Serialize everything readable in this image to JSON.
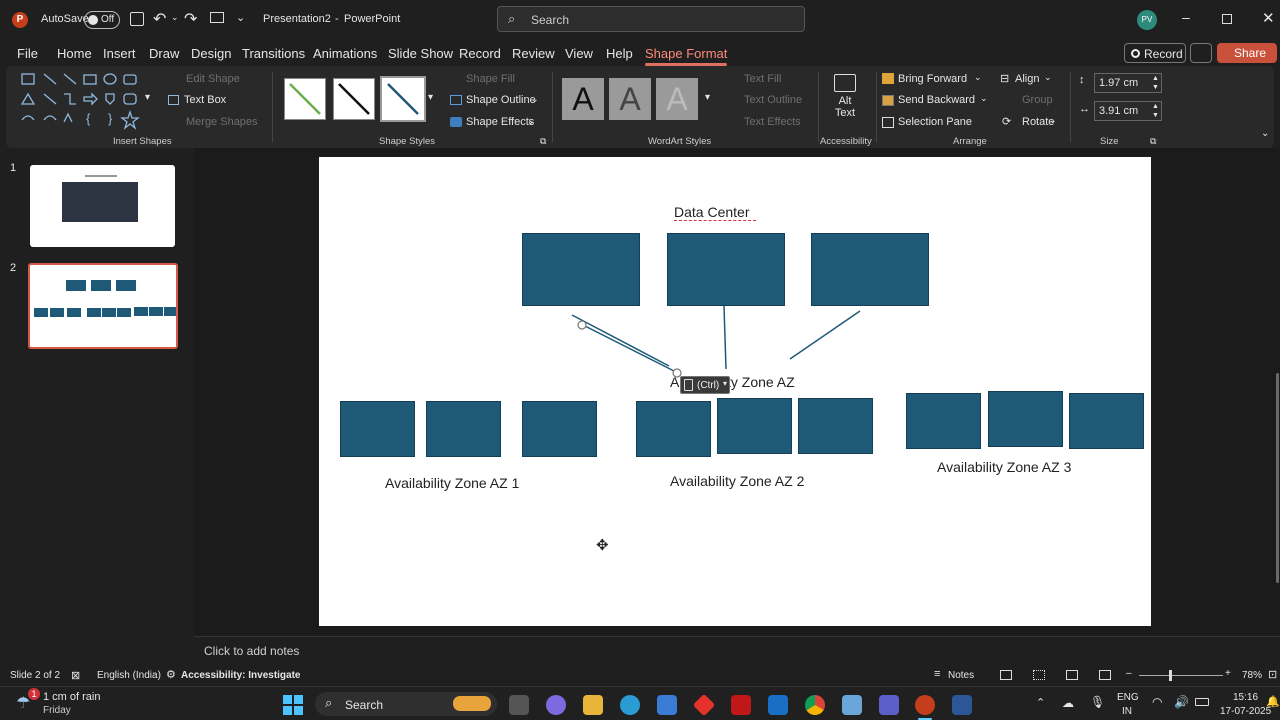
{
  "titlebar": {
    "autosave_label": "AutoSave",
    "autosave_state": "Off",
    "doc_title": "Presentation2",
    "app_name": "PowerPoint",
    "search_placeholder": "Search",
    "user_initials": "PV"
  },
  "menu": {
    "items": [
      "File",
      "Home",
      "Insert",
      "Draw",
      "Design",
      "Transitions",
      "Animations",
      "Slide Show",
      "Record",
      "Review",
      "View",
      "Help",
      "Shape Format"
    ],
    "active": "Shape Format",
    "record_button": "Record",
    "share_button": "Share"
  },
  "ribbon": {
    "insert_shapes": {
      "label": "Insert Shapes",
      "edit_shape": "Edit Shape",
      "text_box": "Text Box",
      "merge_shapes": "Merge Shapes"
    },
    "shape_styles": {
      "label": "Shape Styles",
      "shape_fill": "Shape Fill",
      "shape_outline": "Shape Outline",
      "shape_effects": "Shape Effects"
    },
    "wordart_styles": {
      "label": "WordArt Styles",
      "sample": "A",
      "text_fill": "Text Fill",
      "text_outline": "Text Outline",
      "text_effects": "Text Effects"
    },
    "accessibility": {
      "label": "Accessibility",
      "alt_text_line1": "Alt",
      "alt_text_line2": "Text"
    },
    "arrange": {
      "label": "Arrange",
      "bring_forward": "Bring Forward",
      "send_backward": "Send Backward",
      "selection_pane": "Selection Pane",
      "align": "Align",
      "group": "Group",
      "rotate": "Rotate"
    },
    "size": {
      "label": "Size",
      "height": "1.97 cm",
      "width": "3.91 cm"
    }
  },
  "slides_panel": {
    "slide_numbers": [
      "1",
      "2"
    ],
    "selected_slide": 2
  },
  "slide": {
    "data_center_title": "Data Center",
    "az_label": "Availability Zone AZ",
    "az_partial_left": "A",
    "az_partial_right": "ty Zone AZ",
    "paste_tag": "(Ctrl)",
    "az1_label": "Availability Zone AZ 1",
    "az2_label": "Availability Zone AZ 2",
    "az3_label": "Availability Zone AZ 3",
    "box_color": "#1e5a78"
  },
  "notes": {
    "placeholder": "Click to add notes"
  },
  "statusbar": {
    "slide_info": "Slide 2 of 2",
    "language": "English (India)",
    "accessibility": "Accessibility: Investigate",
    "notes_button": "Notes",
    "zoom": "78%"
  },
  "taskbar": {
    "weather_badge": "1",
    "weather_text": "1 cm of rain",
    "weather_day": "Friday",
    "search_label": "Search",
    "lang_line1": "ENG",
    "lang_line2": "IN",
    "time": "15:16",
    "date": "17-07-2025"
  }
}
